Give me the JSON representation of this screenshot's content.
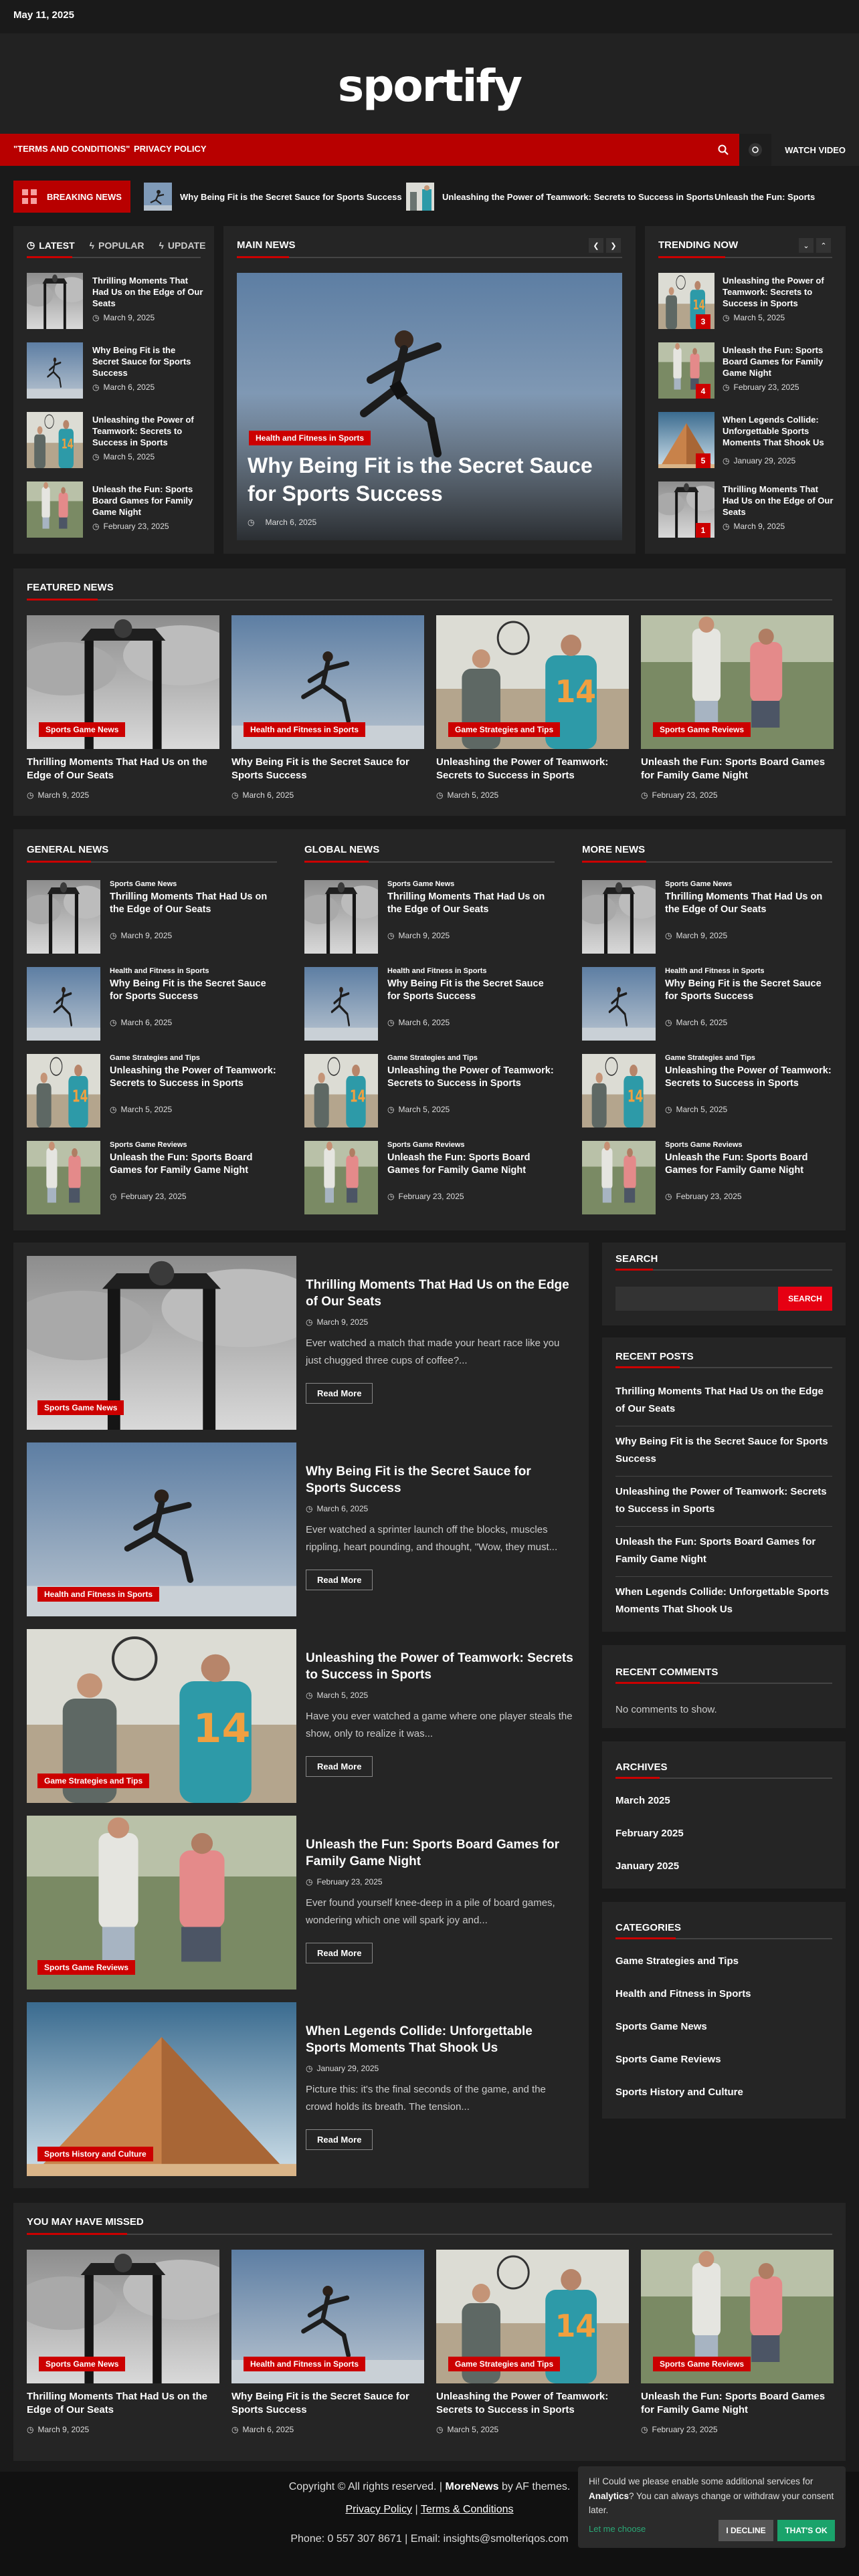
{
  "topbar": {
    "date": "May 11, 2025"
  },
  "brand": {
    "name": "sportify"
  },
  "nav": {
    "links": [
      "\"TERMS AND CONDITIONS\"",
      "PRIVACY POLICY"
    ],
    "watch_label": "WATCH VIDEO"
  },
  "breaking": {
    "label": "BREAKING NEWS",
    "items": [
      "Why Being Fit is the Secret Sauce for Sports Success",
      "Unleashing the Power of Teamwork: Secrets to Success in Sports",
      "Unleash the Fun: Sports"
    ]
  },
  "tabs": [
    "LATEST",
    "POPULAR",
    "UPDATE"
  ],
  "latest": [
    {
      "title": "Thrilling Moments That Had Us on the Edge of Our Seats",
      "date": "March 9, 2025"
    },
    {
      "title": "Why Being Fit is the Secret Sauce for Sports Success",
      "date": "March 6, 2025"
    },
    {
      "title": "Unleashing the Power of Teamwork: Secrets to Success in Sports",
      "date": "March 5, 2025"
    },
    {
      "title": "Unleash the Fun: Sports Board Games for Family Game Night",
      "date": "February 23, 2025"
    }
  ],
  "main_news": {
    "heading": "MAIN NEWS",
    "category": "Health and Fitness in Sports",
    "title": "Why Being Fit is the Secret Sauce for Sports Success",
    "date": "March 6, 2025"
  },
  "trending": {
    "heading": "TRENDING NOW",
    "items": [
      {
        "rank": "3",
        "title": "Unleashing the Power of Teamwork: Secrets to Success in Sports",
        "date": "March 5, 2025"
      },
      {
        "rank": "4",
        "title": "Unleash the Fun: Sports Board Games for Family Game Night",
        "date": "February 23, 2025"
      },
      {
        "rank": "5",
        "title": "When Legends Collide: Unforgettable Sports Moments That Shook Us",
        "date": "January 29, 2025"
      },
      {
        "rank": "1",
        "title": "Thrilling Moments That Had Us on the Edge of Our Seats",
        "date": "March 9, 2025"
      }
    ]
  },
  "featured": {
    "heading": "FEATURED NEWS",
    "items": [
      {
        "category": "Sports Game News",
        "title": "Thrilling Moments That Had Us on the Edge of Our Seats",
        "date": "March 9, 2025"
      },
      {
        "category": "Health and Fitness in Sports",
        "title": "Why Being Fit is the Secret Sauce for Sports Success",
        "date": "March 6, 2025"
      },
      {
        "category": "Game Strategies and Tips",
        "title": "Unleashing the Power of Teamwork: Secrets to Success in Sports",
        "date": "March 5, 2025"
      },
      {
        "category": "Sports Game Reviews",
        "title": "Unleash the Fun: Sports Board Games for Family Game Night",
        "date": "February 23, 2025"
      }
    ]
  },
  "columns": {
    "headings": [
      "GENERAL NEWS",
      "GLOBAL NEWS",
      "MORE NEWS"
    ],
    "items": [
      {
        "category": "Sports Game News",
        "title": "Thrilling Moments That Had Us on the Edge of Our Seats",
        "date": "March 9, 2025"
      },
      {
        "category": "Health and Fitness in Sports",
        "title": "Why Being Fit is the Secret Sauce for Sports Success",
        "date": "March 6, 2025"
      },
      {
        "category": "Game Strategies and Tips",
        "title": "Unleashing the Power of Teamwork: Secrets to Success in Sports",
        "date": "March 5, 2025"
      },
      {
        "category": "Sports Game Reviews",
        "title": "Unleash the Fun: Sports Board Games for Family Game Night",
        "date": "February 23, 2025"
      }
    ]
  },
  "posts": [
    {
      "category": "Sports Game News",
      "title": "Thrilling Moments That Had Us on the Edge of Our Seats",
      "date": "March 9, 2025",
      "excerpt": "Ever watched a match that made your heart race like you just chugged three cups of coffee?..."
    },
    {
      "category": "Health and Fitness in Sports",
      "title": "Why Being Fit is the Secret Sauce for Sports Success",
      "date": "March 6, 2025",
      "excerpt": "Ever watched a sprinter launch off the blocks, muscles rippling, heart pounding, and thought, \"Wow, they must..."
    },
    {
      "category": "Game Strategies and Tips",
      "title": "Unleashing the Power of Teamwork: Secrets to Success in Sports",
      "date": "March 5, 2025",
      "excerpt": "Have you ever watched a game where one player steals the show, only to realize it was..."
    },
    {
      "category": "Sports Game Reviews",
      "title": "Unleash the Fun: Sports Board Games for Family Game Night",
      "date": "February 23, 2025",
      "excerpt": "Ever found yourself knee-deep in a pile of board games, wondering which one will spark joy and..."
    },
    {
      "category": "Sports History and Culture",
      "title": "When Legends Collide: Unforgettable Sports Moments That Shook Us",
      "date": "January 29, 2025",
      "excerpt": "Picture this: it's the final seconds of the game, and the crowd holds its breath. The tension..."
    }
  ],
  "read_more": "Read More",
  "sidebar": {
    "search_heading": "SEARCH",
    "search_button": "SEARCH",
    "recent_posts_heading": "RECENT POSTS",
    "recent_posts": [
      "Thrilling Moments That Had Us on the Edge of Our Seats",
      "Why Being Fit is the Secret Sauce for Sports Success",
      "Unleashing the Power of Teamwork: Secrets to Success in Sports",
      "Unleash the Fun: Sports Board Games for Family Game Night",
      "When Legends Collide: Unforgettable Sports Moments That Shook Us"
    ],
    "recent_comments_heading": "RECENT COMMENTS",
    "no_comments": "No comments to show.",
    "archives_heading": "ARCHIVES",
    "archives": [
      "March 2025",
      "February 2025",
      "January 2025"
    ],
    "categories_heading": "CATEGORIES",
    "categories": [
      "Game Strategies and Tips",
      "Health and Fitness in Sports",
      "Sports Game News",
      "Sports Game Reviews",
      "Sports History and Culture"
    ]
  },
  "missed": {
    "heading": "YOU MAY HAVE MISSED",
    "items": [
      {
        "category": "Sports Game News",
        "title": "Thrilling Moments That Had Us on the Edge of Our Seats",
        "date": "March 9, 2025"
      },
      {
        "category": "Health and Fitness in Sports",
        "title": "Why Being Fit is the Secret Sauce for Sports Success",
        "date": "March 6, 2025"
      },
      {
        "category": "Game Strategies and Tips",
        "title": "Unleashing the Power of Teamwork: Secrets to Success in Sports",
        "date": "March 5, 2025"
      },
      {
        "category": "Sports Game Reviews",
        "title": "Unleash the Fun: Sports Board Games for Family Game Night",
        "date": "February 23, 2025"
      }
    ]
  },
  "footer": {
    "copyright": "Copyright © All rights reserved.",
    "sep": "|",
    "theme_name": "MoreNews",
    "by": "by AF themes.",
    "privacy": "Privacy Policy",
    "terms": "Terms & Conditions",
    "contact": "Phone: 0 557 307 8671 | Email: insights@smolteriqos.com"
  },
  "cookie": {
    "text_before": "Hi! Could we please enable some additional services for",
    "bold": "Analytics",
    "text_after": "? You can always change or withdraw your consent later.",
    "choose": "Let me choose",
    "decline": "I DECLINE",
    "accept": "THAT'S OK"
  },
  "colors": {
    "accent": "#c00000",
    "nav": "#b80000",
    "accept": "#1aa36b"
  }
}
